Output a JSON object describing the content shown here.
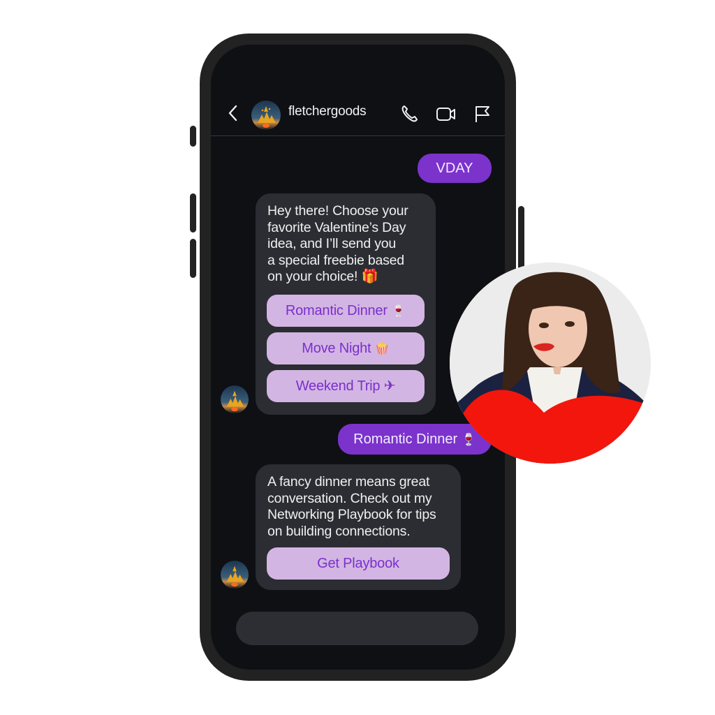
{
  "header": {
    "back_icon": "chevron-left-icon",
    "username": "fletchergoods",
    "actions": [
      {
        "name": "phone-call-button",
        "icon": "phone-icon"
      },
      {
        "name": "video-call-button",
        "icon": "video-camera-icon"
      },
      {
        "name": "report-button",
        "icon": "flag-icon"
      }
    ]
  },
  "messages": [
    {
      "type": "outgoing",
      "text": "VDAY"
    },
    {
      "type": "incoming",
      "text": "Hey there! Choose your favorite Valentine’s Day idea, and I’ll send you a special freebie based on your choice! 🎁",
      "lines": [
        "Hey there! Choose your",
        "favorite Valentine’s Day",
        "idea, and I’ll send you",
        "a special freebie based",
        "on your choice! 🎁"
      ],
      "quick_replies": [
        {
          "label": "Romantic Dinner",
          "emoji": "🍷"
        },
        {
          "label": "Move Night",
          "emoji": "🍿"
        },
        {
          "label": "Weekend Trip",
          "emoji": "✈"
        }
      ]
    },
    {
      "type": "outgoing",
      "text": "Romantic Dinner",
      "emoji": "🍷"
    },
    {
      "type": "incoming",
      "lines": [
        "A fancy dinner means great",
        "conversation. Check out my",
        "Networking Playbook for tips",
        "on building connections."
      ],
      "button": {
        "label": "Get Playbook"
      }
    }
  ],
  "composer": {
    "placeholder": ""
  },
  "colors": {
    "accent_purple": "#7b33cc",
    "quick_reply_bg": "#d3b5e3",
    "quick_reply_text": "#7a30cc",
    "bubble_incoming": "#2b2d33",
    "screen_bg": "#0e1014",
    "heart_red": "#f3160c"
  }
}
